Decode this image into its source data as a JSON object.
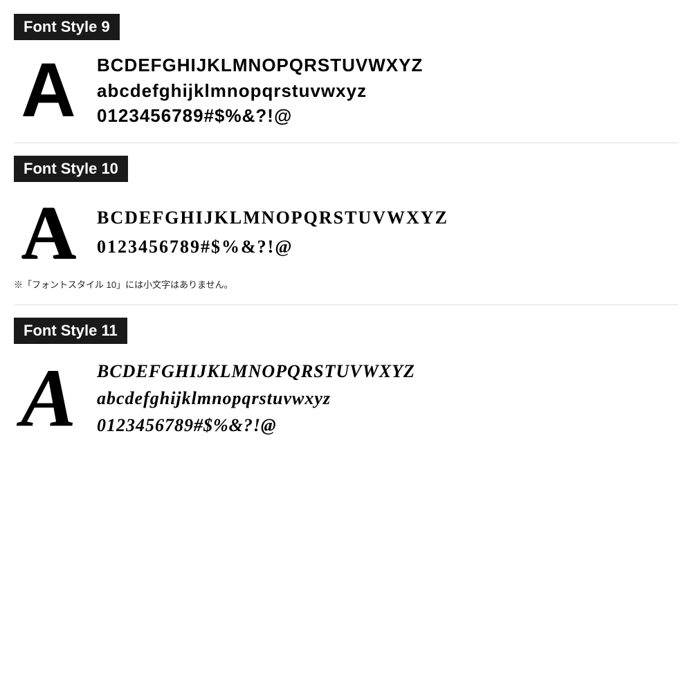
{
  "sections": [
    {
      "id": "font-style-9",
      "label": "Font Style 9",
      "big_letter": "A",
      "lines": [
        "BCDEFGHIJKLMNOPQRSTUVWXYZ",
        "abcdefghijklmnopqrstuvwxyz",
        "0123456789#$%&?!@"
      ],
      "note": null
    },
    {
      "id": "font-style-10",
      "label": "Font Style 10",
      "big_letter": "A",
      "lines": [
        "BCDEFGHIJKLMNOPQRSTUVWXYZ",
        "0123456789#$%&?!@"
      ],
      "note": "※「フォントスタイル 10」には小文字はありません。"
    },
    {
      "id": "font-style-11",
      "label": "Font Style 11",
      "big_letter": "A",
      "lines": [
        "BCDEFGHIJKLMNOPQRSTUVWXYZ",
        "abcdefghijklmnopqrstuvwxyz",
        "0123456789#$%&?!@"
      ],
      "note": null
    }
  ],
  "colors": {
    "label_bg": "#1a1a1a",
    "label_text": "#ffffff",
    "char_color": "#000000",
    "bg": "#ffffff"
  }
}
